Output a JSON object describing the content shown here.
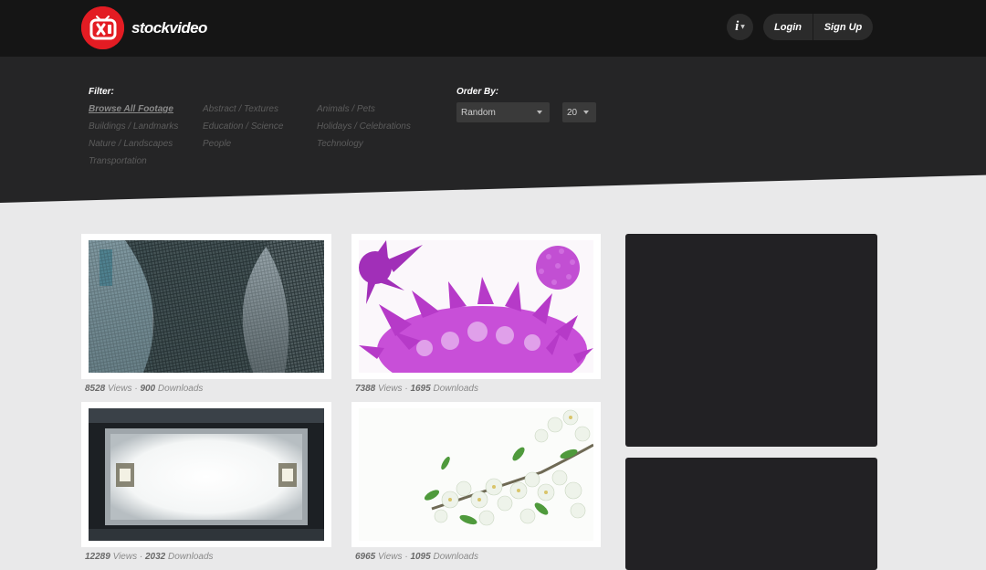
{
  "header": {
    "brand": "stockvideo",
    "info_label": "i",
    "login_label": "Login",
    "signup_label": "Sign Up"
  },
  "filter": {
    "label": "Filter:",
    "links": [
      "Browse All Footage",
      "Abstract / Textures",
      "Animals / Pets",
      "Buildings / Landmarks",
      "Education / Science",
      "Holidays / Celebrations",
      "Nature / Landscapes",
      "People",
      "Technology",
      "Transportation"
    ]
  },
  "order": {
    "label": "Order By:",
    "sort_value": "Random",
    "count_value": "20"
  },
  "videos": [
    {
      "views": "8528",
      "views_label": "Views",
      "sep": "·",
      "downloads": "900",
      "downloads_label": "Downloads",
      "thumb": "fishing-net-thumbnail"
    },
    {
      "views": "7388",
      "views_label": "Views",
      "sep": "·",
      "downloads": "1695",
      "downloads_label": "Downloads",
      "thumb": "purple-virus-thumbnail"
    },
    {
      "views": "12289",
      "views_label": "Views",
      "sep": "·",
      "downloads": "2032",
      "downloads_label": "Downloads",
      "thumb": "light-panel-thumbnail"
    },
    {
      "views": "6965",
      "views_label": "Views",
      "sep": "·",
      "downloads": "1095",
      "downloads_label": "Downloads",
      "thumb": "white-blossom-thumbnail"
    }
  ],
  "colors": {
    "brand_red": "#e31c23",
    "header_bg": "#151515",
    "filter_bg": "#252526",
    "page_bg": "#e9e9ea",
    "ad_bg": "#222124"
  }
}
